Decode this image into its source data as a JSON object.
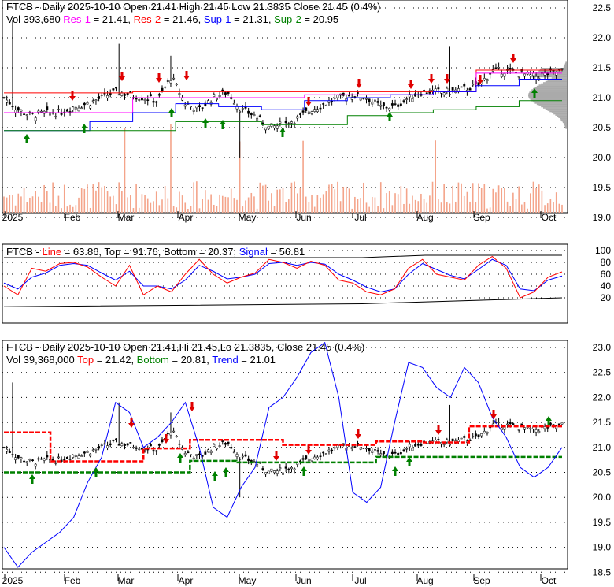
{
  "chart_data": [
    {
      "type": "candlestick",
      "title": "FTCB - Daily 2025-10-10 Open 21.41  High 21.45  Low 21.3835  Close 21.45 (0.4%)",
      "legend": [
        {
          "text": "Vol 393,680 ",
          "color": "#000000"
        },
        {
          "text": "Res-1",
          "color": "#ff00ff"
        },
        {
          "text": " = 21.41, ",
          "color": "#000000"
        },
        {
          "text": "Res-2",
          "color": "#ff0000"
        },
        {
          "text": " = 21.46, ",
          "color": "#000000"
        },
        {
          "text": "Sup-1",
          "color": "#0000ff"
        },
        {
          "text": " = 21.31, ",
          "color": "#000000"
        },
        {
          "text": "Sup-2",
          "color": "#008000"
        },
        {
          "text": " = 20.95",
          "color": "#000000"
        }
      ],
      "yticks": [
        "22.5",
        "22.0",
        "21.5",
        "21.0",
        "20.5",
        "20.0",
        "19.5",
        "19.0"
      ],
      "ylim": [
        18.8,
        22.6
      ]
    },
    {
      "type": "line",
      "title_parts": [
        {
          "text": "FTCB - ",
          "color": "#000000"
        },
        {
          "text": "Line",
          "color": "#ff0000"
        },
        {
          "text": " = 63.86, Top = 91.76, Bottom = 20.37, ",
          "color": "#000000"
        },
        {
          "text": "Signal",
          "color": "#0000ff"
        },
        {
          "text": " = 56.81",
          "color": "#000000"
        }
      ],
      "yticks": [
        "100",
        "80",
        "60",
        "40",
        "20"
      ],
      "ylim": [
        0,
        100
      ],
      "line": [
        40,
        25,
        70,
        65,
        78,
        80,
        72,
        55,
        40,
        75,
        25,
        40,
        30,
        60,
        85,
        60,
        45,
        55,
        62,
        85,
        80,
        70,
        82,
        75,
        50,
        45,
        30,
        25,
        35,
        70,
        85,
        60,
        55,
        50,
        75,
        90,
        70,
        20,
        30,
        55,
        64
      ],
      "signal": [
        45,
        35,
        55,
        62,
        75,
        78,
        75,
        62,
        50,
        65,
        40,
        40,
        35,
        50,
        75,
        65,
        52,
        55,
        60,
        78,
        80,
        75,
        80,
        77,
        60,
        50,
        38,
        30,
        35,
        60,
        78,
        68,
        58,
        52,
        68,
        85,
        75,
        35,
        32,
        50,
        57
      ]
    },
    {
      "type": "candlestick",
      "title": "FTCB - Daily 2025-10-10 Open 21.41,Hi 21.45,Lo 21.3835, Close 21.45 (0.4%)",
      "legend": [
        {
          "text": "Vol 39,368,000 ",
          "color": "#000000"
        },
        {
          "text": "Top",
          "color": "#ff0000"
        },
        {
          "text": " = 21.42, ",
          "color": "#000000"
        },
        {
          "text": "Bottom",
          "color": "#008000"
        },
        {
          "text": " = 20.81, ",
          "color": "#000000"
        },
        {
          "text": "Trend",
          "color": "#0000ff"
        },
        {
          "text": " = 21.01",
          "color": "#000000"
        }
      ],
      "yticks": [
        "23.0",
        "22.5",
        "22.0",
        "21.5",
        "21.0",
        "20.5",
        "20.0",
        "19.5",
        "19.0",
        "18.5"
      ],
      "ylim": [
        18.4,
        23.2
      ],
      "trend": [
        19.0,
        18.6,
        18.9,
        19.1,
        19.3,
        19.6,
        20.3,
        20.8,
        21.9,
        21.7,
        21.0,
        21.2,
        21.5,
        21.9,
        21.0,
        19.8,
        19.6,
        20.2,
        20.6,
        21.8,
        22.0,
        22.4,
        22.9,
        23.1,
        22.0,
        20.1,
        19.9,
        20.2,
        21.5,
        22.7,
        22.6,
        22.2,
        22.0,
        22.6,
        22.3,
        21.6,
        21.2,
        20.6,
        20.4,
        20.6,
        21.0
      ]
    },
    {
      "type": "closes",
      "xlabels": [
        "2025",
        "Feb",
        "Mar",
        "Apr",
        "May",
        "Jun",
        "Jul",
        "Aug",
        "Sep",
        "Oct"
      ],
      "closes": [
        21.0,
        20.8,
        20.7,
        20.75,
        20.75,
        20.85,
        20.9,
        21.0,
        21.1,
        21.05,
        21.0,
        20.95,
        21.35,
        20.9,
        20.8,
        21.0,
        21.1,
        20.8,
        20.7,
        20.5,
        20.55,
        20.65,
        20.8,
        20.9,
        21.0,
        21.05,
        21.0,
        20.85,
        20.85,
        21.0,
        21.1,
        21.1,
        21.1,
        21.15,
        21.2,
        21.45,
        21.45,
        21.4,
        21.35,
        21.4,
        21.45
      ]
    }
  ]
}
